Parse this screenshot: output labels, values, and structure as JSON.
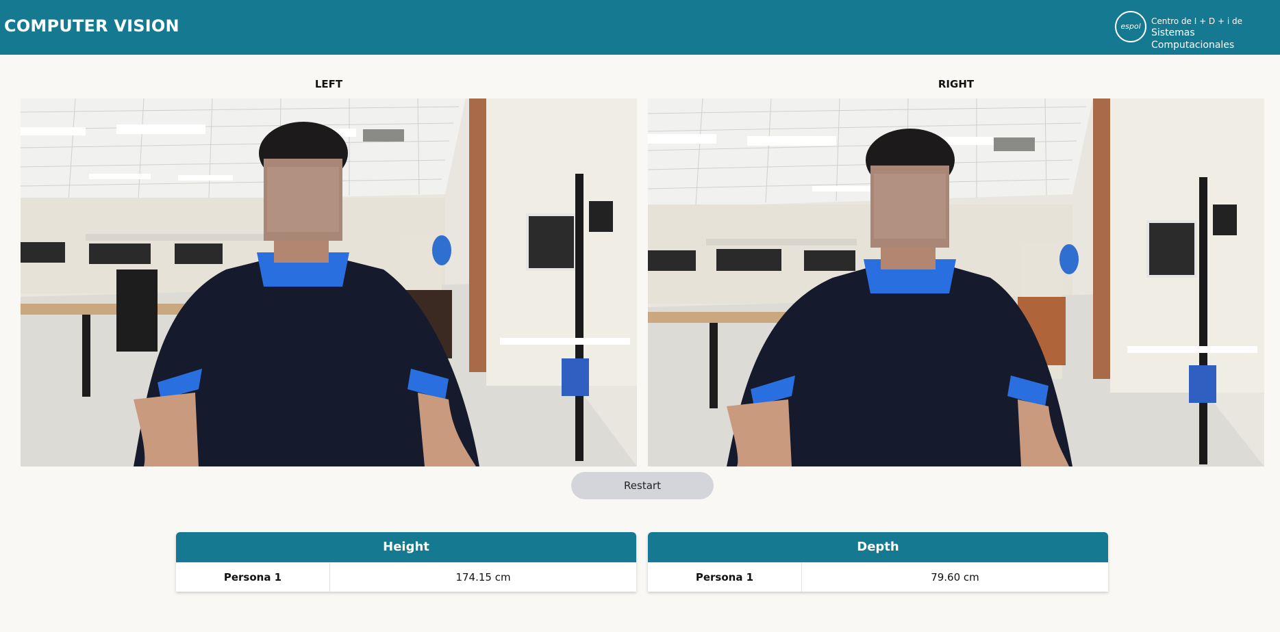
{
  "app": {
    "title": "COMPUTER VISION",
    "logo": {
      "mark": "espol",
      "line1": "Centro de I + D + i de",
      "line2": "Sistemas Computacionales"
    }
  },
  "cameras": {
    "left": {
      "label": "LEFT"
    },
    "right": {
      "label": "RIGHT"
    }
  },
  "controls": {
    "restart_label": "Restart"
  },
  "results": {
    "height": {
      "title": "Height",
      "rows": [
        {
          "name": "Persona 1",
          "value": "174.15 cm"
        }
      ]
    },
    "depth": {
      "title": "Depth",
      "rows": [
        {
          "name": "Persona 1",
          "value": "79.60 cm"
        }
      ]
    }
  },
  "colors": {
    "primary": "#157991",
    "background": "#faf8f5",
    "button": "#d3d5da"
  }
}
